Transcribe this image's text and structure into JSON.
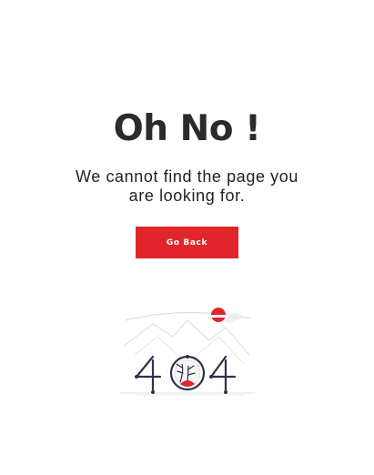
{
  "notfound": {
    "title": "Oh No !",
    "message": "We cannot find the page you are looking for.",
    "button_label": "Go Back"
  },
  "illustration": {
    "icon": "404-illustration",
    "accent_color": "#e0262a",
    "ink_color": "#2e3148"
  }
}
